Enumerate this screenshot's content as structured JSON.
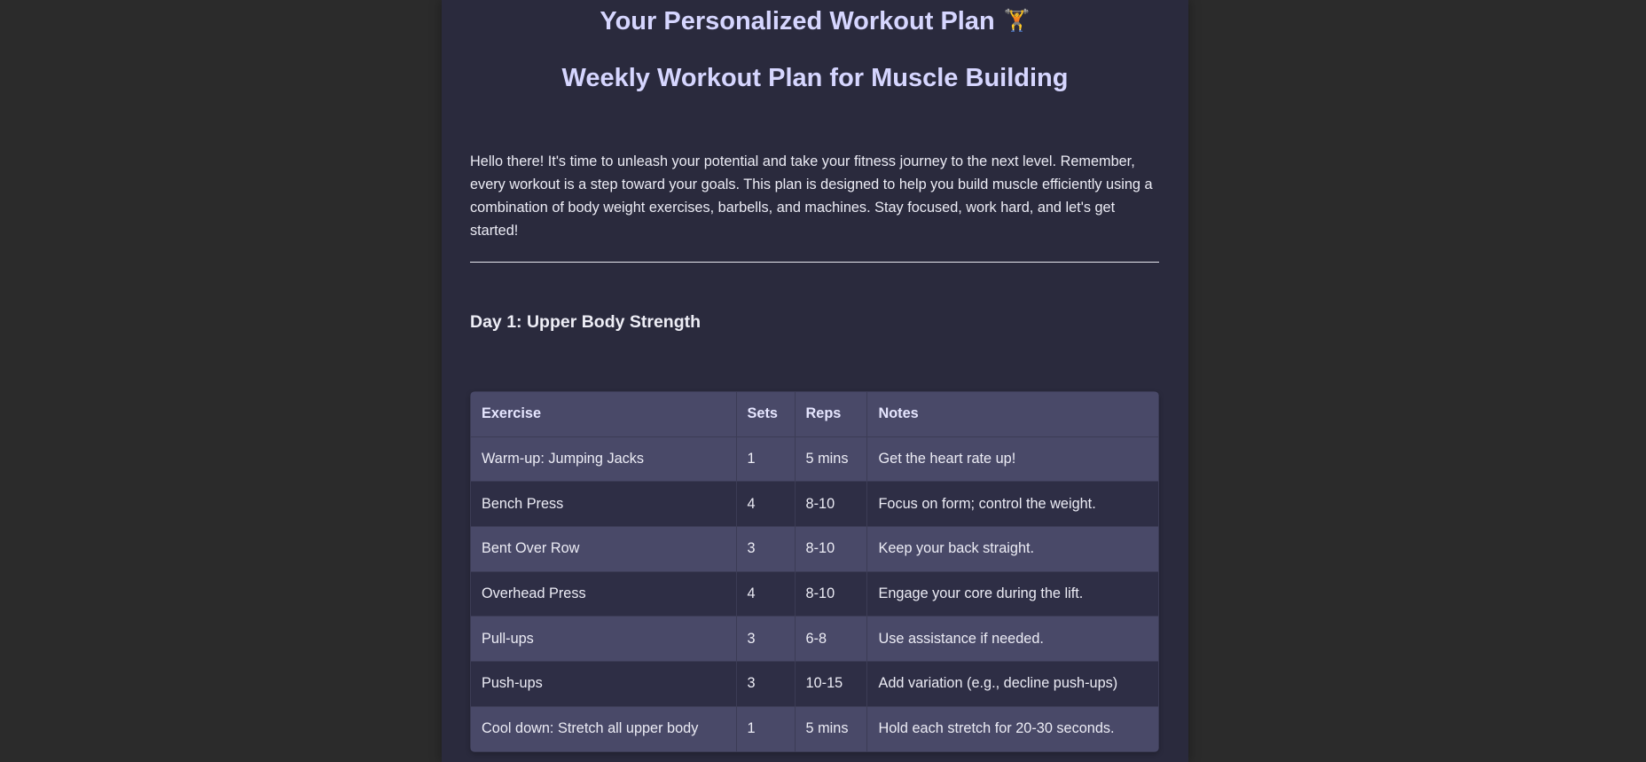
{
  "header": {
    "title": "Your Personalized Workout Plan",
    "title_emoji": "🏋️",
    "subtitle": "Weekly Workout Plan for Muscle Building"
  },
  "intro": {
    "text": "Hello there! It's time to unleash your potential and take your fitness journey to the next level. Remember, every workout is a step toward your goals. This plan is designed to help you build muscle efficiently using a combination of body weight exercises, barbells, and machines. Stay focused, work hard, and let's get started!"
  },
  "day1": {
    "heading": "Day 1: Upper Body Strength",
    "columns": [
      "Exercise",
      "Sets",
      "Reps",
      "Notes"
    ],
    "rows": [
      [
        "Warm-up: Jumping Jacks",
        "1",
        "5 mins",
        "Get the heart rate up!"
      ],
      [
        "Bench Press",
        "4",
        "8-10",
        "Focus on form; control the weight."
      ],
      [
        "Bent Over Row",
        "3",
        "8-10",
        "Keep your back straight."
      ],
      [
        "Overhead Press",
        "4",
        "8-10",
        "Engage your core during the lift."
      ],
      [
        "Pull-ups",
        "3",
        "6-8",
        "Use assistance if needed."
      ],
      [
        "Push-ups",
        "3",
        "10-15",
        "Add variation (e.g., decline push-ups)"
      ],
      [
        "Cool down: Stretch all upper body",
        "1",
        "5 mins",
        "Hold each stretch for 20-30 seconds."
      ]
    ]
  },
  "colors": {
    "background": "#2b2b2b",
    "panel": "#2a2a3d",
    "heading": "#d6d6ff",
    "row_light": "#494968",
    "row_dark": "#2e2e45"
  }
}
